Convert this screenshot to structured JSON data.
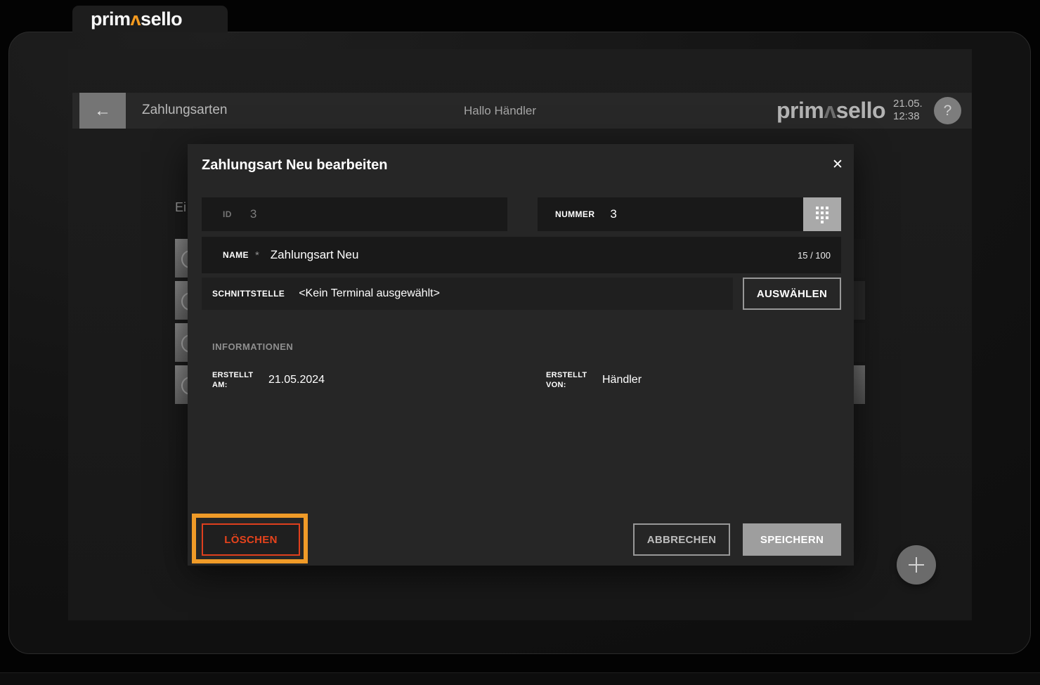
{
  "tab": {
    "logo": {
      "p1": "prim",
      "caret": "ʌ",
      "p2": "sello"
    }
  },
  "header": {
    "back_icon": "←",
    "title": "Zahlungsarten",
    "greeting": "Hallo Händler",
    "logo": {
      "p1": "prim",
      "caret": "ʌ",
      "p2": "sello"
    },
    "date": "21.05.",
    "time": "12:38",
    "help": "?"
  },
  "background": {
    "partial_label": "Ei"
  },
  "modal": {
    "title": "Zahlungsart Neu bearbeiten",
    "close": "✕",
    "fields": {
      "id": {
        "label": "ID",
        "value": "3"
      },
      "nummer": {
        "label": "NUMMER",
        "value": "3"
      },
      "name": {
        "label": "NAME",
        "required": "*",
        "value": "Zahlungsart Neu",
        "counter": "15 / 100"
      },
      "schnittstelle": {
        "label": "SCHNITTSTELLE",
        "value": "<Kein Terminal ausgewählt>",
        "button": "AUSWÄHLEN"
      }
    },
    "info": {
      "heading": "INFORMATIONEN",
      "created_at": {
        "label": "ERSTELLT AM:",
        "value": "21.05.2024"
      },
      "created_by": {
        "label": "ERSTELLT VON:",
        "value": "Händler"
      }
    },
    "actions": {
      "delete": "LÖSCHEN",
      "cancel": "ABBRECHEN",
      "save": "SPEICHERN"
    }
  },
  "fab": {
    "label": "+"
  },
  "colors": {
    "brand_orange": "#f49a1f",
    "delete_red": "#e7431c",
    "annotation_orange": "#f09b28",
    "modal_bg": "#262626",
    "field_bg": "#191919",
    "save_gray": "#9e9e9e"
  }
}
